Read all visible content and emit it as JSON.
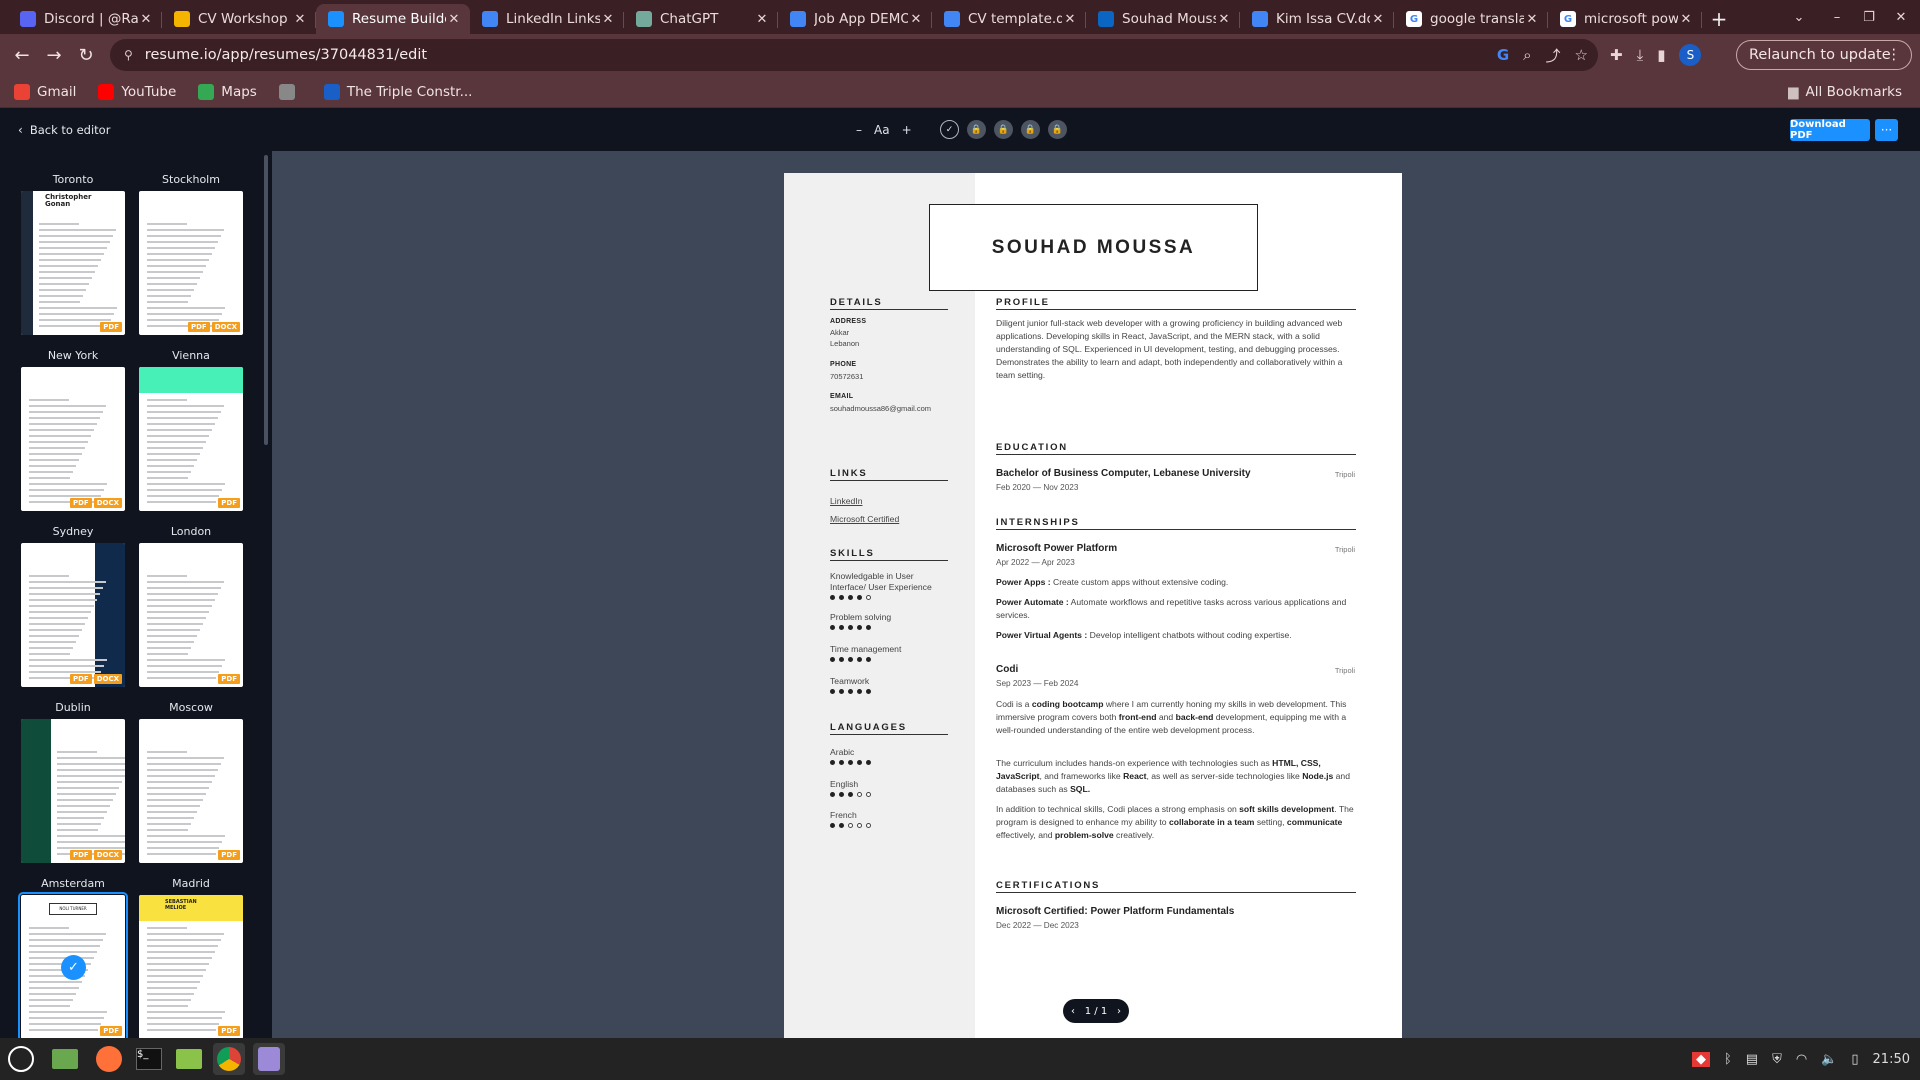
{
  "browser": {
    "tabs": [
      {
        "title": "Discord | @Ra",
        "favicon": "discord-icon",
        "color": "#5865f2"
      },
      {
        "title": "CV Workshop",
        "favicon": "slides-icon",
        "color": "#f4b400"
      },
      {
        "title": "Resume Builde",
        "favicon": "resume-io-icon",
        "color": "#1a91ff",
        "active": true
      },
      {
        "title": "LinkedIn Links",
        "favicon": "docs-icon",
        "color": "#4285f4"
      },
      {
        "title": "ChatGPT",
        "favicon": "chatgpt-icon",
        "color": "#74aa9c"
      },
      {
        "title": "Job App DEMO",
        "favicon": "docs-icon",
        "color": "#4285f4"
      },
      {
        "title": "CV template.d",
        "favicon": "docs-icon",
        "color": "#4285f4"
      },
      {
        "title": "Souhad Mouss",
        "favicon": "linkedin-icon",
        "color": "#0a66c2"
      },
      {
        "title": "Kim Issa CV.do",
        "favicon": "docs-icon",
        "color": "#4285f4"
      },
      {
        "title": "google transla",
        "favicon": "google-icon",
        "color": "#ffffff"
      },
      {
        "title": "microsoft pow",
        "favicon": "google-icon",
        "color": "#ffffff"
      }
    ],
    "url": "resume.io/app/resumes/37044831/edit",
    "relaunch_label": "Relaunch to update",
    "profile_initial": "S",
    "bookmarks": [
      {
        "label": "Gmail",
        "icon": "gmail-icon",
        "color": "#ea4335"
      },
      {
        "label": "YouTube",
        "icon": "youtube-icon",
        "color": "#ff0000"
      },
      {
        "label": "Maps",
        "icon": "maps-icon",
        "color": "#34a853"
      },
      {
        "label": "",
        "icon": "globe-icon",
        "color": "#888888"
      },
      {
        "label": "The Triple Constr...",
        "icon": "site-icon",
        "color": "#1a5fc8"
      }
    ],
    "all_bookmarks": "All Bookmarks"
  },
  "app": {
    "back_label": "Back to editor",
    "font_label": "Aa",
    "font_minus": "–",
    "font_plus": "+",
    "download_label": "Download PDF",
    "more_label": "···"
  },
  "templates": [
    {
      "name": "Toronto",
      "badges": [
        "PDF"
      ]
    },
    {
      "name": "Stockholm",
      "badges": [
        "PDF",
        "DOCX"
      ]
    },
    {
      "name": "New York",
      "badges": [
        "PDF",
        "DOCX"
      ]
    },
    {
      "name": "Vienna",
      "badges": [
        "PDF"
      ]
    },
    {
      "name": "Sydney",
      "badges": [
        "PDF",
        "DOCX"
      ]
    },
    {
      "name": "London",
      "badges": [
        "PDF"
      ]
    },
    {
      "name": "Dublin",
      "badges": [
        "PDF",
        "DOCX"
      ]
    },
    {
      "name": "Moscow",
      "badges": [
        "PDF"
      ]
    },
    {
      "name": "Amsterdam",
      "badges": [
        "PDF"
      ],
      "selected": true
    },
    {
      "name": "Madrid",
      "badges": [
        "PDF"
      ]
    }
  ],
  "thumb_text": {
    "toronto_name": "Christopher Gonan",
    "amsterdam_name": "NOLI TURNER",
    "madrid_name": "SEBASTIAN MELIOE"
  },
  "resume": {
    "name": "SOUHAD MOUSSA",
    "details_heading": "DETAILS",
    "address_label": "ADDRESS",
    "address_lines": [
      "Akkar",
      "Lebanon"
    ],
    "phone_label": "PHONE",
    "phone": "70572631",
    "email_label": "EMAIL",
    "email": "souhadmoussa86@gmail.com",
    "links_heading": "LINKS",
    "links": [
      "LinkedIn",
      "Microsoft Certified"
    ],
    "skills_heading": "SKILLS",
    "skills": [
      {
        "name": "Knowledgable in User Interface/ User Experience",
        "level": 4
      },
      {
        "name": "Problem solving",
        "level": 5
      },
      {
        "name": "Time management",
        "level": 5
      },
      {
        "name": "Teamwork",
        "level": 5
      }
    ],
    "languages_heading": "LANGUAGES",
    "languages": [
      {
        "name": "Arabic",
        "level": 5
      },
      {
        "name": "English",
        "level": 3
      },
      {
        "name": "French",
        "level": 2
      }
    ],
    "profile_heading": "PROFILE",
    "profile": "Diligent junior full-stack web developer with a growing proficiency in building advanced web applications. Developing skills in React, JavaScript, and the MERN stack, with a solid understanding of SQL. Experienced in UI development, testing, and debugging processes. Demonstrates the ability to learn and adapt, both independently and collaboratively within a team setting.",
    "education_heading": "EDUCATION",
    "education": {
      "title": "Bachelor of Business Computer, Lebanese University",
      "dates": "Feb 2020 — Nov 2023",
      "location": "Tripoli"
    },
    "internships_heading": "INTERNSHIPS",
    "intern1": {
      "title": "Microsoft Power Platform",
      "dates": "Apr 2022 — Apr 2023",
      "location": "Tripoli",
      "items": [
        {
          "label": "Power Apps :",
          "text": " Create custom apps without extensive coding."
        },
        {
          "label": "Power Automate :",
          "text": " Automate workflows and repetitive tasks across various applications and services."
        },
        {
          "label": "Power Virtual Agents :",
          "text": " Develop intelligent chatbots without coding expertise."
        }
      ]
    },
    "intern2": {
      "title": "Codi",
      "dates": "Sep 2023 — Feb 2024",
      "location": "Tripoli",
      "p1": [
        {
          "t": "Codi is a "
        },
        {
          "b": "coding bootcamp"
        },
        {
          "t": " where I am currently honing my skills in web development. This immersive program covers both "
        },
        {
          "b": "front-end"
        },
        {
          "t": " and "
        },
        {
          "b": "back-end"
        },
        {
          "t": " development, equipping me with a well-rounded understanding of the entire web development process."
        }
      ],
      "p2": [
        {
          "t": " The curriculum includes hands-on experience with technologies such as "
        },
        {
          "b": "HTML, CSS, JavaScript"
        },
        {
          "t": ", and frameworks like "
        },
        {
          "b": "React"
        },
        {
          "t": ", as well as server-side technologies like "
        },
        {
          "b": "Node.js"
        },
        {
          "t": " and databases such as "
        },
        {
          "b": "SQL."
        }
      ],
      "p3": [
        {
          "t": "In addition to technical skills, Codi places a strong emphasis on "
        },
        {
          "b": "soft skills development"
        },
        {
          "t": ". The program is designed to enhance my ability to "
        },
        {
          "b": "collaborate in a team"
        },
        {
          "t": " setting, "
        },
        {
          "b": "communicate"
        },
        {
          "t": " effectively, and "
        },
        {
          "b": "problem-solve"
        },
        {
          "t": " creatively."
        }
      ]
    },
    "certifications_heading": "CERTIFICATIONS",
    "certification": {
      "title": "Microsoft Certified: Power Platform Fundamentals",
      "dates": "Dec 2022 — Dec 2023"
    }
  },
  "pager": {
    "label": "1 / 1"
  },
  "taskbar": {
    "time": "21:50"
  }
}
